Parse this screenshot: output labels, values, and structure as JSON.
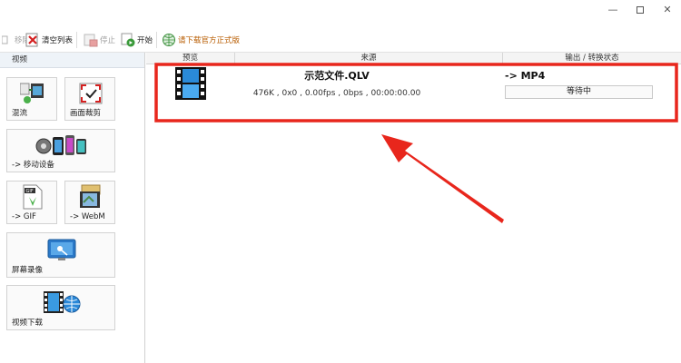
{
  "window": {
    "minimize_label": "—",
    "close_label": "✕"
  },
  "toolbar": {
    "remove_label": "移除",
    "clear_label": "清空列表",
    "stop_label": "停止",
    "start_label": "开始",
    "download_label": "请下载官方正式版"
  },
  "sidebar": {
    "header": "视频",
    "tiles": [
      {
        "label": "混流",
        "icon": "mux-icon"
      },
      {
        "label": "画面裁剪",
        "icon": "crop-icon"
      },
      {
        "label": "-> 移动设备",
        "icon": "mobile-device-icon"
      },
      {
        "label": "-> GIF",
        "icon": "gif-icon"
      },
      {
        "label": "-> WebM",
        "icon": "webm-icon"
      },
      {
        "label": "屏幕录像",
        "icon": "screen-record-icon"
      },
      {
        "label": "视频下载",
        "icon": "video-download-icon"
      }
    ]
  },
  "list": {
    "columns": [
      "预览",
      "来源",
      "输出 / 转换状态"
    ],
    "rows": [
      {
        "file_name": "示范文件.QLV",
        "info": "476K , 0x0 , 0.00fps , 0bps , 00:00:00.00",
        "output_format": "-> MP4",
        "status": "等待中"
      }
    ]
  },
  "colors": {
    "annotation_red": "#e8261c",
    "toolbar_link": "#b85c00"
  }
}
